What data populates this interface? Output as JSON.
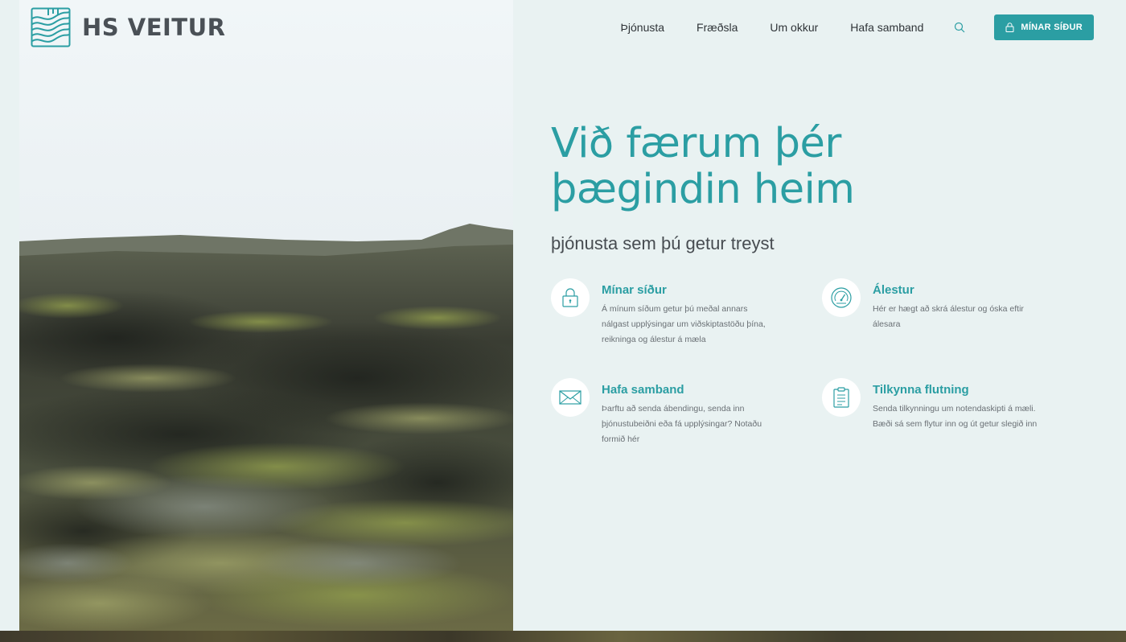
{
  "brand": {
    "name": "HS VEITUR",
    "accent": "#2b9ea3",
    "logo_icon": "hs-veitur-wave-logo-icon"
  },
  "nav": {
    "items": [
      {
        "label": "Þjónusta"
      },
      {
        "label": "Fræðsla"
      },
      {
        "label": "Um okkur"
      },
      {
        "label": "Hafa samband"
      }
    ],
    "search_icon": "search-icon",
    "login_label": "MÍNAR SÍÐUR",
    "login_icon": "lock-icon"
  },
  "hero": {
    "headline_line1": "Við færum þér",
    "headline_line2": "þægindin heim",
    "subtitle": "þjónusta sem þú getur treyst"
  },
  "features": [
    {
      "title": "Mínar síður",
      "description": "Á mínum síðum getur þú meðal annars nálgast upplýsingar um viðskiptastöðu þína, reikninga og álestur á mæla",
      "icon": "lock-icon"
    },
    {
      "title": "Álestur",
      "description": "Hér er hægt að skrá álestur og óska eftir álesara",
      "icon": "gauge-icon"
    },
    {
      "title": "Hafa samband",
      "description": "Þarftu að senda ábendingu, senda inn þjónustubeiðni eða fá upplýsingar? Notaðu formið hér",
      "icon": "envelope-icon"
    },
    {
      "title": "Tilkynna flutning",
      "description": "Senda tilkynningu um notendaskipti á mæli. Bæði sá sem flytur inn og út getur slegið inn",
      "icon": "clipboard-icon"
    }
  ]
}
